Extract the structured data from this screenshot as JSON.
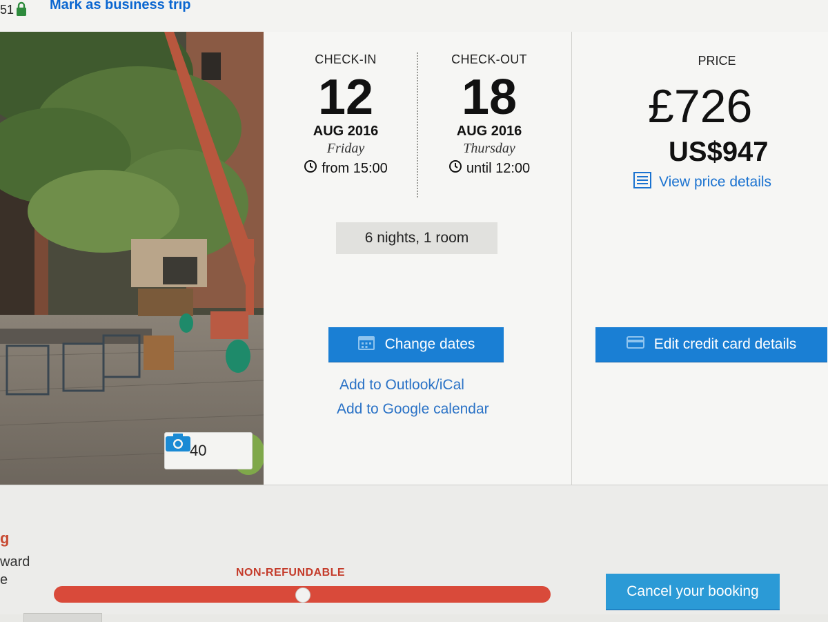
{
  "topbar": {
    "partial_number": "51",
    "mark_business_trip": "Mark as business trip"
  },
  "photo": {
    "count": "40"
  },
  "dates": {
    "check_in": {
      "label": "CHECK-IN",
      "day": "12",
      "month_year": "AUG 2016",
      "weekday": "Friday",
      "time": "from 15:00"
    },
    "check_out": {
      "label": "CHECK-OUT",
      "day": "18",
      "month_year": "AUG 2016",
      "weekday": "Thursday",
      "time": "until 12:00"
    },
    "nights_rooms": "6 nights, 1 room",
    "change_dates_label": "Change dates",
    "add_outlook_label": "Add to Outlook/iCal",
    "add_google_label": "Add to Google calendar"
  },
  "price": {
    "label": "PRICE",
    "gbp": "£726",
    "usd": "US$947",
    "view_details_label": "View price details",
    "edit_card_label": "Edit credit card details"
  },
  "policy": {
    "partial_heading": "g",
    "partial_line_1": "ward",
    "partial_line_2": "e",
    "refund_status": "NON-REFUNDABLE",
    "cancel_label": "Cancel your booking"
  },
  "colors": {
    "primary_button": "#1a7fd4",
    "cancel_button": "#2b9ad6",
    "link": "#2a72c6",
    "non_refundable": "#d94a3a"
  },
  "icons": {
    "lock": "lock-icon",
    "camera": "camera-icon",
    "clock": "clock-icon",
    "calendar": "calendar-icon",
    "price_details": "receipt-icon",
    "credit_card": "credit-card-icon"
  }
}
